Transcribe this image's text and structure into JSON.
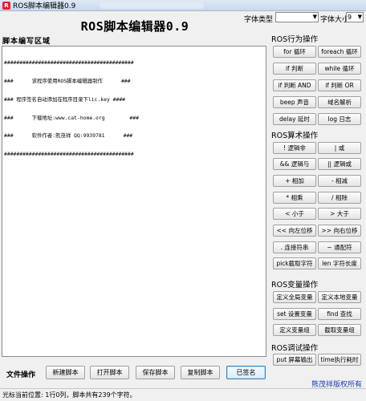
{
  "window": {
    "title": "ROS脚本编辑器0.9",
    "icon_text": "R"
  },
  "header": {
    "app_title": "ROS脚本编辑器0.9"
  },
  "font_controls": {
    "type_label": "字体类型",
    "type_value": "",
    "size_label": "字体大小",
    "size_value": "9"
  },
  "editor": {
    "title": "脚本编写区域",
    "lines": [
      "##########################################",
      "###      该程序使用ROS脚本编辑器制作      ###",
      "### 程序签名自动添加在程序目录下lic.key ####",
      "###      下载地址:www.cat-home.org        ###",
      "###      软件作者:熊茂祥 QQ:9939781      ###",
      "##########################################"
    ]
  },
  "sections": {
    "flow": {
      "title": "ROS行为操作",
      "buttons": [
        "for 循环",
        "foreach 循环",
        "if 判断",
        "while 循环",
        "if 判断 AND",
        "if 判断 OR",
        "beep 声音",
        "域名解析",
        "delay 延时",
        "log 日志"
      ]
    },
    "operators": {
      "title": "ROS算术操作",
      "buttons": [
        "! 逻辑非",
        "| 或",
        "&& 逻辑与",
        "|| 逻辑或",
        "+ 相加",
        "- 相减",
        "* 相乘",
        "/ 相除",
        "< 小于",
        "> 大于",
        "<< 向左位移",
        ">> 向右位移",
        ". 连接符串",
        "~ 通配符",
        "pick截取字符",
        "len 字符长度"
      ]
    },
    "variables": {
      "title": "ROS变量操作",
      "buttons": [
        "定义全局变量",
        "定义本地变量",
        "set 设置变量",
        "find 查找",
        "定义变量组",
        "截取变量组"
      ]
    },
    "debug": {
      "title": "ROS调试操作",
      "buttons": [
        "put 屏幕输出",
        "time执行耗时"
      ]
    }
  },
  "file_ops": {
    "label": "文件操作",
    "buttons": [
      "新建脚本",
      "打开脚本",
      "保存脚本",
      "复制脚本",
      "已签名"
    ]
  },
  "copyright": "熊茂祥版权所有",
  "status": "光标当前位置: 1行0列，脚本共有239个字符。"
}
